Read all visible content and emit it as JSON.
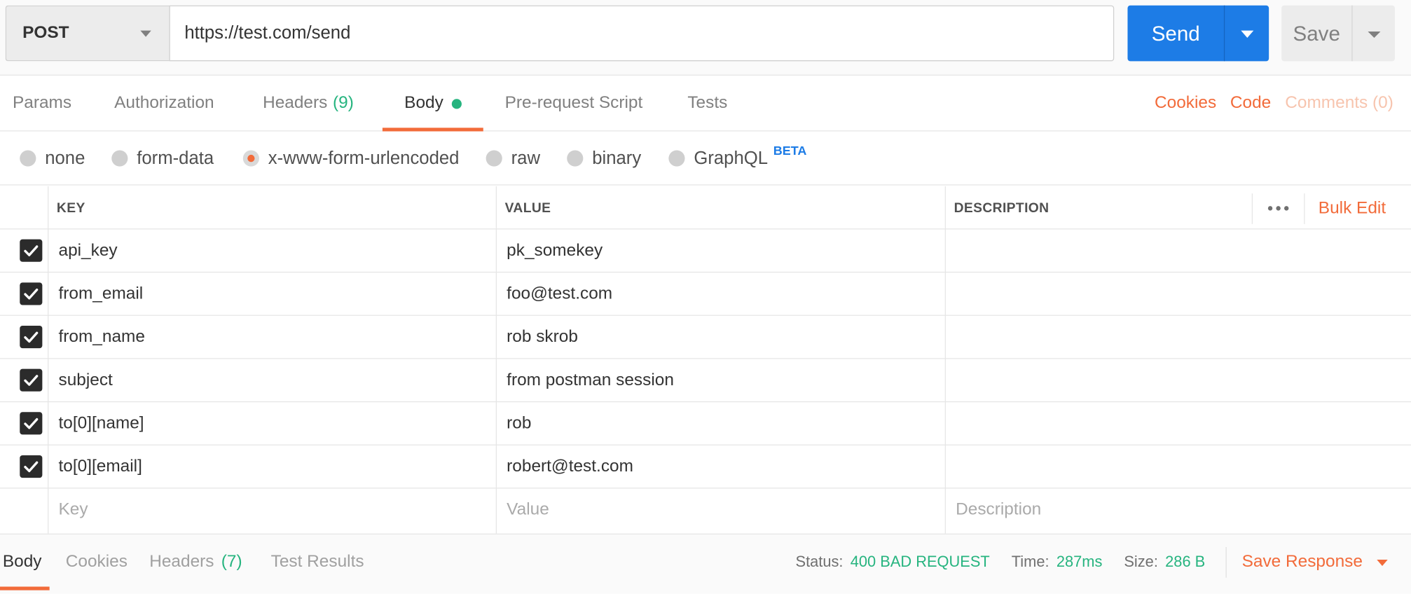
{
  "request": {
    "method": "POST",
    "url": "https://test.com/send",
    "send_label": "Send",
    "save_label": "Save"
  },
  "tabs": [
    {
      "label": "Params",
      "count": "",
      "active": false
    },
    {
      "label": "Authorization",
      "count": "",
      "active": false
    },
    {
      "label": "Headers",
      "count": "(9)",
      "active": false
    },
    {
      "label": "Body",
      "count": "",
      "active": true,
      "indicator": "green-dot"
    },
    {
      "label": "Pre-request Script",
      "count": "",
      "active": false
    },
    {
      "label": "Tests",
      "count": "",
      "active": false
    }
  ],
  "links": {
    "cookies": "Cookies",
    "code": "Code",
    "comments": "Comments (0)"
  },
  "body_types": {
    "options": [
      "none",
      "form-data",
      "x-www-form-urlencoded",
      "raw",
      "binary",
      "GraphQL"
    ],
    "selected": "x-www-form-urlencoded",
    "graphql_badge": "BETA"
  },
  "table": {
    "headers": {
      "key": "KEY",
      "value": "VALUE",
      "description": "DESCRIPTION"
    },
    "bulk_edit": "Bulk Edit",
    "rows": [
      {
        "checked": true,
        "key": "api_key",
        "value": "pk_somekey",
        "description": ""
      },
      {
        "checked": true,
        "key": "from_email",
        "value": "foo@test.com",
        "description": ""
      },
      {
        "checked": true,
        "key": "from_name",
        "value": "rob skrob",
        "description": ""
      },
      {
        "checked": true,
        "key": "subject",
        "value": "from postman session",
        "description": ""
      },
      {
        "checked": true,
        "key": "to[0][name]",
        "value": "rob",
        "description": ""
      },
      {
        "checked": true,
        "key": "to[0][email]",
        "value": "robert@test.com",
        "description": ""
      }
    ],
    "placeholders": {
      "key": "Key",
      "value": "Value",
      "description": "Description"
    }
  },
  "response": {
    "tabs": [
      {
        "label": "Body",
        "count": "",
        "active": true
      },
      {
        "label": "Cookies",
        "count": "",
        "active": false
      },
      {
        "label": "Headers",
        "count": "(7)",
        "active": false
      },
      {
        "label": "Test Results",
        "count": "",
        "active": false
      }
    ],
    "status_label": "Status:",
    "status_value": "400 BAD REQUEST",
    "time_label": "Time:",
    "time_value": "287ms",
    "size_label": "Size:",
    "size_value": "286 B",
    "save_response": "Save Response"
  },
  "colors": {
    "accent": "#f26b3a",
    "primary": "#1d7ce6",
    "success": "#26b47f"
  }
}
